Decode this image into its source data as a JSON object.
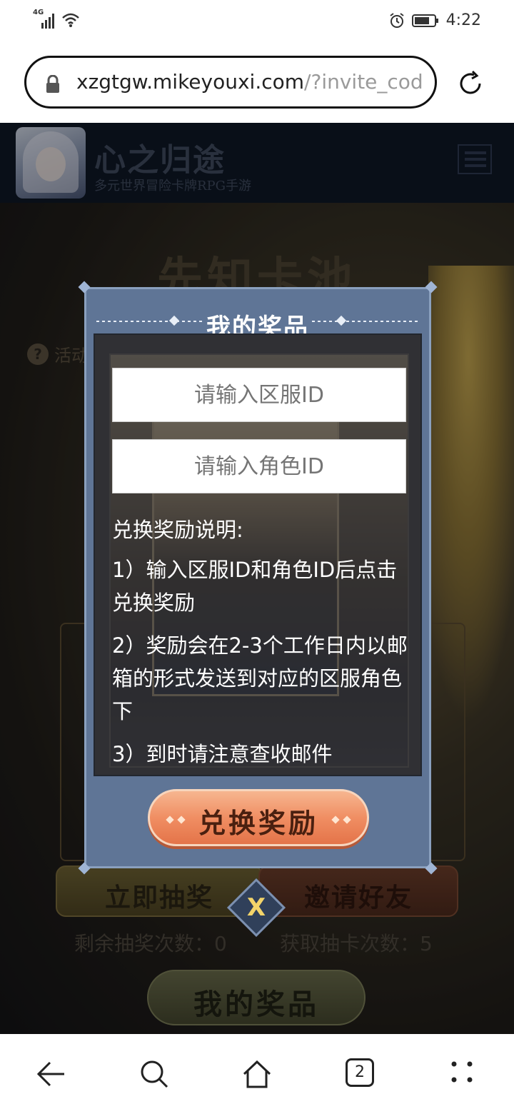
{
  "status_bar": {
    "network": "4G",
    "time": "4:22"
  },
  "browser": {
    "url_host": "xzgtgw.mikeyouxi.com",
    "url_path": "/?invite_cod",
    "tab_count": "2"
  },
  "site": {
    "title": "心之归途",
    "subtitle": "多元世界冒险卡牌RPG手游",
    "banner_title": "先知卡池",
    "rules_label": "活动"
  },
  "modal": {
    "title": "我的奖品",
    "server_id_placeholder": "请输入区服ID",
    "role_id_placeholder": "请输入角色ID",
    "desc_heading": "兑换奖励说明:",
    "desc_items": [
      "1）输入区服ID和角色ID后点击兑换奖励",
      "2）奖励会在2-3个工作日内以邮箱的形式发送到对应的区服角色下",
      "3）到时请注意查收邮件"
    ],
    "redeem_label": "兑换奖励",
    "close_label": "X"
  },
  "page": {
    "draw_now_label": "立即抽奖",
    "invite_friends_label": "邀请好友",
    "remaining_draws": "剩余抽奖次数：0",
    "earned_draws": "获取抽卡次数：5",
    "my_prizes_label": "我的奖品"
  },
  "colors": {
    "modal_bg": "#5f7596",
    "redeem_button": "#f08e63",
    "header_bg": "#0e1726"
  }
}
